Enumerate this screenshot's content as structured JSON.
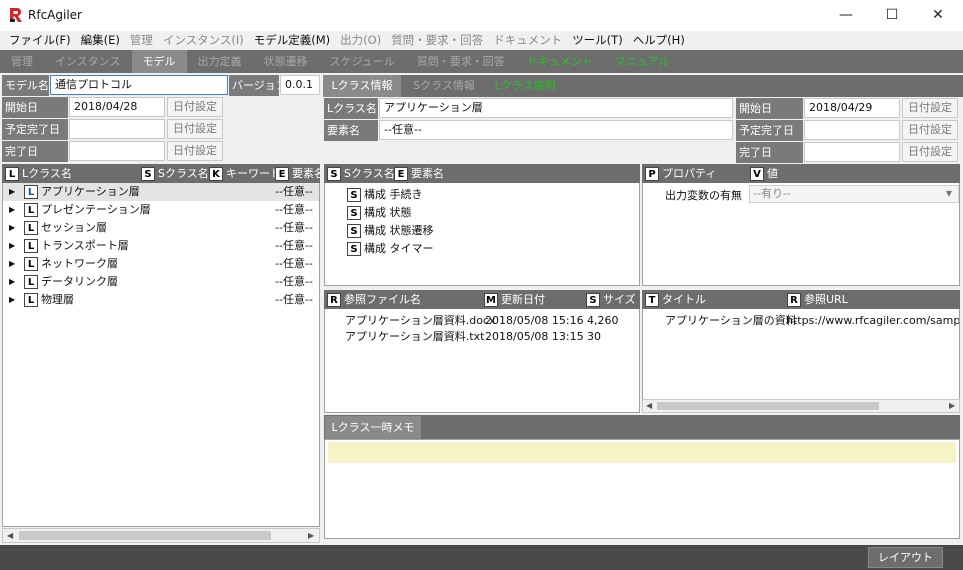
{
  "window": {
    "title": "RfcAgiler",
    "minimize_glyph": "—",
    "maximize_glyph": "☐",
    "close_glyph": "✕"
  },
  "menu": [
    {
      "label": "ファイル(F)",
      "enabled": true
    },
    {
      "label": "編集(E)",
      "enabled": true
    },
    {
      "label": "管理",
      "enabled": false
    },
    {
      "label": "インスタンス(I)",
      "enabled": false
    },
    {
      "label": "モデル定義(M)",
      "enabled": true
    },
    {
      "label": "出力(O)",
      "enabled": false
    },
    {
      "label": "質問・要求・回答",
      "enabled": false
    },
    {
      "label": "ドキュメント",
      "enabled": false
    },
    {
      "label": "ツール(T)",
      "enabled": true
    },
    {
      "label": "ヘルプ(H)",
      "enabled": true
    }
  ],
  "tabs": [
    "管理",
    "インスタンス",
    "モデル",
    "出力定義",
    "状態遷移",
    "スケジュール",
    "質問・要求・回答",
    "ドキュメント",
    "マニュアル"
  ],
  "model": {
    "name_label": "モデル名",
    "name_value": "通信プロトコル",
    "version_label": "バージョン",
    "version_value": "0.0.1",
    "start_label": "開始日",
    "start_value": "2018/04/28",
    "planned_label": "予定完了日",
    "planned_value": "",
    "done_label": "完了日",
    "done_value": "",
    "date_btn": "日付設定"
  },
  "tree": {
    "headers": [
      {
        "badge": "L",
        "label": "Lクラス名"
      },
      {
        "badge": "S",
        "label": "Sクラス名"
      },
      {
        "badge": "K",
        "label": "キーワード"
      },
      {
        "badge": "E",
        "label": "要素名"
      }
    ],
    "items": [
      {
        "badge": "L",
        "label": "アプリケーション層",
        "value": "--任意--"
      },
      {
        "badge": "L",
        "label": "プレゼンテーション層",
        "value": "--任意--"
      },
      {
        "badge": "L",
        "label": "セッション層",
        "value": "--任意--"
      },
      {
        "badge": "L",
        "label": "トランスポート層",
        "value": "--任意--"
      },
      {
        "badge": "L",
        "label": "ネットワーク層",
        "value": "--任意--"
      },
      {
        "badge": "L",
        "label": "データリンク層",
        "value": "--任意--"
      },
      {
        "badge": "L",
        "label": "物理層",
        "value": "--任意--"
      }
    ]
  },
  "subtabs": [
    "Lクラス情報",
    "Sクラス情報",
    "Lクラス説明"
  ],
  "lclass": {
    "name_label": "Lクラス名",
    "name_value": "アプリケーション層",
    "element_label": "要素名",
    "element_value": "--任意--",
    "start_label": "開始日",
    "start_value": "2018/04/29",
    "planned_label": "予定完了日",
    "done_label": "完了日",
    "date_btn": "日付設定"
  },
  "sclass": {
    "headers": [
      {
        "badge": "S",
        "label": "Sクラス名"
      },
      {
        "badge": "E",
        "label": "要素名"
      }
    ],
    "items": [
      {
        "badge": "S",
        "label": "構成 手続き"
      },
      {
        "badge": "S",
        "label": "構成 状態"
      },
      {
        "badge": "S",
        "label": "構成 状態遷移"
      },
      {
        "badge": "S",
        "label": "構成 タイマー"
      }
    ]
  },
  "props": {
    "headers": [
      {
        "badge": "P",
        "label": "プロパティ"
      },
      {
        "badge": "V",
        "label": "値"
      }
    ],
    "items": [
      {
        "label": "出力変数の有無",
        "value": "--有り--"
      }
    ]
  },
  "files": {
    "headers": [
      {
        "badge": "R",
        "label": "参照ファイル名"
      },
      {
        "badge": "M",
        "label": "更新日付"
      },
      {
        "badge": "S",
        "label": "サイズ"
      }
    ],
    "items": [
      {
        "name": "アプリケーション層資料.docx",
        "date": "2018/05/08 15:16",
        "size": "4,260"
      },
      {
        "name": "アプリケーション層資料.txt",
        "date": "2018/05/08 13:15",
        "size": "30"
      }
    ]
  },
  "urls": {
    "headers": [
      {
        "badge": "T",
        "label": "タイトル"
      },
      {
        "badge": "R",
        "label": "参照URL"
      }
    ],
    "items": [
      {
        "title": "アプリケーション層の資料",
        "url": "https://www.rfcagiler.com/sample"
      }
    ]
  },
  "memo": {
    "tab": "Lクラス一時メモ",
    "text": ""
  },
  "status": {
    "layout_btn": "レイアウト"
  },
  "colors": {
    "accent_green": "#22c322",
    "header_gray": "#6d6d6d",
    "memo_yellow": "#f6f3c6",
    "logo_red": "#d8232a"
  }
}
